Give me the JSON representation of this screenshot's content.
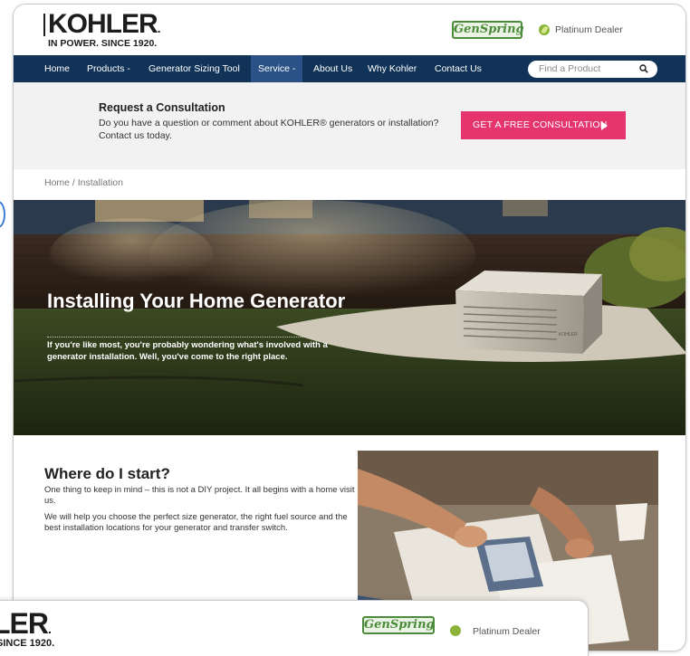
{
  "header": {
    "logo_word": "KOHLER",
    "logo_dot": ".",
    "logo_tagline": "IN POWER. SINCE 1920.",
    "partner_logo": "GenSpring",
    "dealer_label": "Platinum Dealer"
  },
  "nav": {
    "items": [
      {
        "label": "Home"
      },
      {
        "label": "Products -"
      },
      {
        "label": "Generator Sizing Tool"
      },
      {
        "label": "Service -"
      },
      {
        "label": "About Us"
      },
      {
        "label": "Why Kohler"
      },
      {
        "label": "Contact Us"
      }
    ],
    "search_placeholder": "Find a Product"
  },
  "consult": {
    "title": "Request a Consultation",
    "text": "Do you have a question or comment about KOHLER® generators or installation? Contact us today.",
    "cta_label": "GET A FREE CONSULTATION"
  },
  "breadcrumb": "Home / Installation",
  "hero": {
    "title": "Installing Your Home Generator",
    "subtitle": "If you're like most, you're probably wondering what's involved with a generator installation. Well, you've come to the right place.",
    "generator_badge": "KOHLER"
  },
  "content": {
    "title": "Where do I start?",
    "p1": "One thing to keep in mind – this is not a DIY project. It all begins with a home visit us.",
    "p2": "We will help you choose the perfect size generator, the right fuel source and the best installation locations for your generator and transfer switch."
  },
  "footer_preview": {
    "logo_word": "LER",
    "logo_dot": ".",
    "logo_tagline": "SINCE 1920.",
    "partner_logo": "GenSpring",
    "dealer_label": "Platinum Dealer"
  },
  "colors": {
    "nav_bg": "#113357",
    "nav_active": "#2a5286",
    "cta": "#e5346e",
    "genspring_green": "#4b8b3b"
  }
}
